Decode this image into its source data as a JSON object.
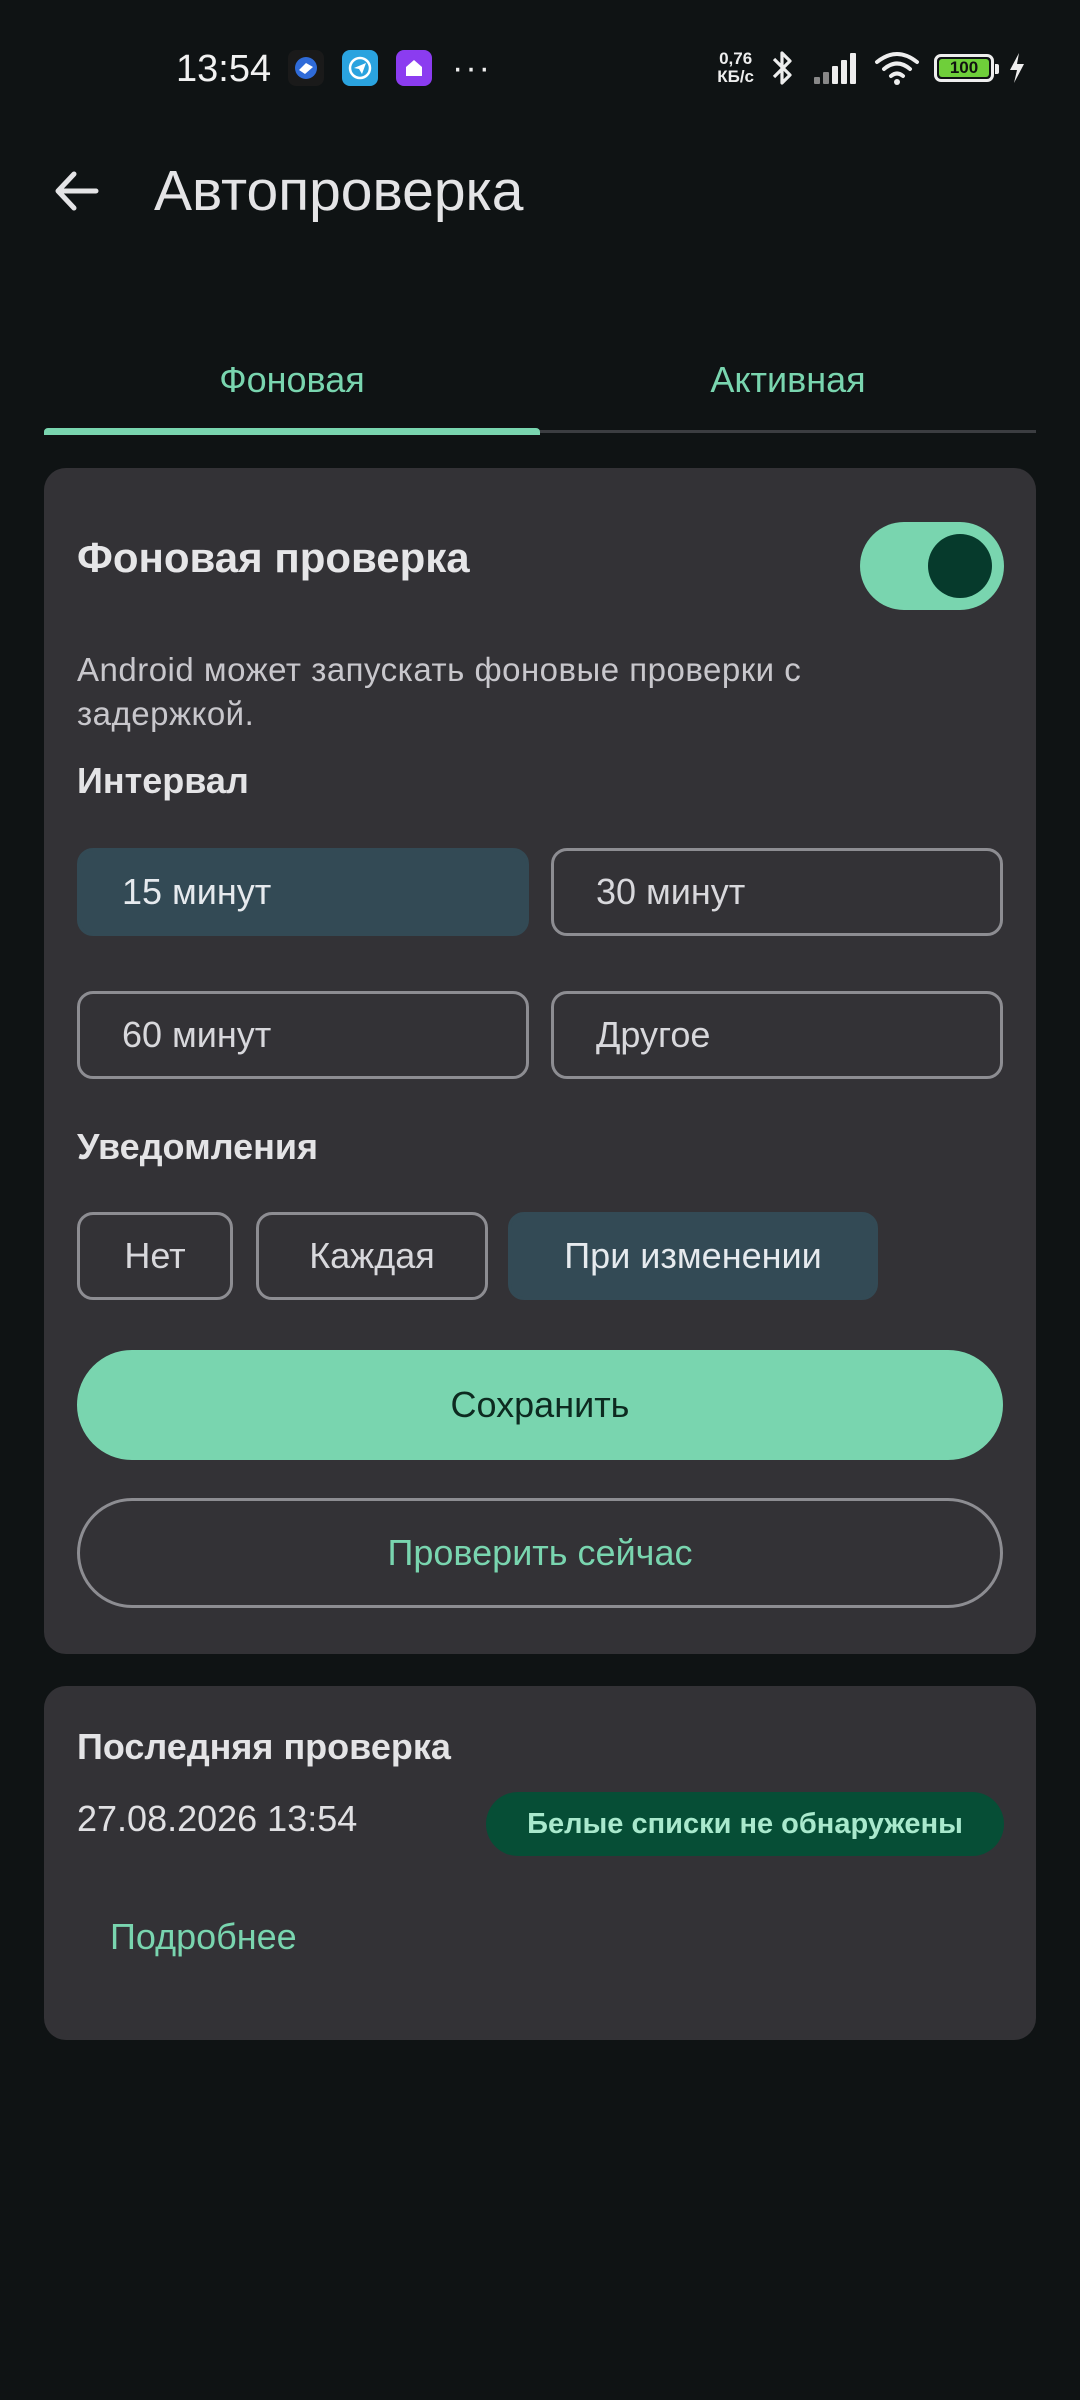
{
  "status_bar": {
    "time": "13:54",
    "app_icons": [
      "vpn-app-icon",
      "telegram-icon",
      "home-app-icon"
    ],
    "more": "···",
    "net_speed_value": "0,76",
    "net_speed_unit": "КБ/с",
    "battery_level": "100",
    "icons": [
      "bluetooth-icon",
      "signal-icon",
      "wifi-icon",
      "battery-icon",
      "charging-icon"
    ]
  },
  "app_bar": {
    "title": "Автопроверка"
  },
  "tabs": [
    {
      "label": "Фоновая",
      "selected": true
    },
    {
      "label": "Активная",
      "selected": false
    }
  ],
  "background_check": {
    "title": "Фоновая проверка",
    "enabled": true,
    "description": "Android может запускать фоновые проверки с задержкой.",
    "interval_label": "Интервал",
    "intervals": [
      {
        "label": "15 минут",
        "selected": true
      },
      {
        "label": "30 минут",
        "selected": false
      },
      {
        "label": "60 минут",
        "selected": false
      },
      {
        "label": "Другое",
        "selected": false
      }
    ],
    "notifications_label": "Уведомления",
    "notifications": [
      {
        "label": "Нет",
        "selected": false
      },
      {
        "label": "Каждая",
        "selected": false
      },
      {
        "label": "При изменении",
        "selected": true
      }
    ],
    "save_label": "Сохранить",
    "check_now_label": "Проверить сейчас"
  },
  "last_check": {
    "title": "Последняя проверка",
    "datetime": "27.08.2026 13:54",
    "status": "Белые списки не обнаружены",
    "details_label": "Подробнее"
  },
  "colors": {
    "accent": "#79d5af",
    "background": "#0f1314",
    "card": "#333236",
    "selected_chip": "#334a55",
    "badge": "#064e36"
  }
}
